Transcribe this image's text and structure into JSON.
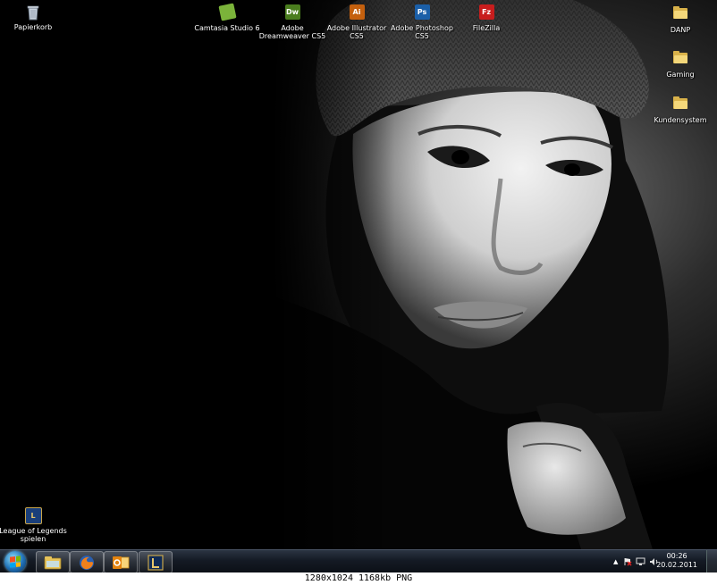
{
  "desktop": {
    "icons_top": [
      {
        "name": "Papierkorb",
        "type": "recycle-bin"
      },
      {
        "name": "Camtasia Studio 6",
        "type": "app",
        "badge": "",
        "color": "#7bb33a"
      },
      {
        "name": "Adobe Dreamweaver CS5",
        "type": "app",
        "badge": "Dw",
        "color": "#4a7d1e"
      },
      {
        "name": "Adobe Illustrator CS5",
        "type": "app",
        "badge": "Ai",
        "color": "#c4600e"
      },
      {
        "name": "Adobe Photoshop CS5",
        "type": "app",
        "badge": "Ps",
        "color": "#1b5fa8"
      },
      {
        "name": "FileZilla",
        "type": "app",
        "badge": "Fz",
        "color": "#c81d1d"
      }
    ],
    "icons_right": [
      {
        "name": "DANP",
        "type": "folder"
      },
      {
        "name": "Gaming",
        "type": "folder"
      },
      {
        "name": "Kundensystem",
        "type": "folder"
      }
    ],
    "icon_bottom": {
      "name": "League of Legends spielen",
      "type": "game",
      "badge": "L",
      "color": "#1a3f7a"
    }
  },
  "taskbar": {
    "pinned": [
      {
        "name": "Windows Explorer",
        "icon": "explorer-icon"
      },
      {
        "name": "Mozilla Firefox",
        "icon": "firefox-icon"
      },
      {
        "name": "Microsoft Outlook",
        "icon": "outlook-icon"
      },
      {
        "name": "League of Legends",
        "icon": "league-of-legends-icon"
      }
    ],
    "tray": {
      "show_hidden": "▲",
      "clock_time": "00:26",
      "clock_date": "20.02.2011"
    }
  },
  "info_bar": {
    "text": "1280x1024 1168kb PNG"
  }
}
